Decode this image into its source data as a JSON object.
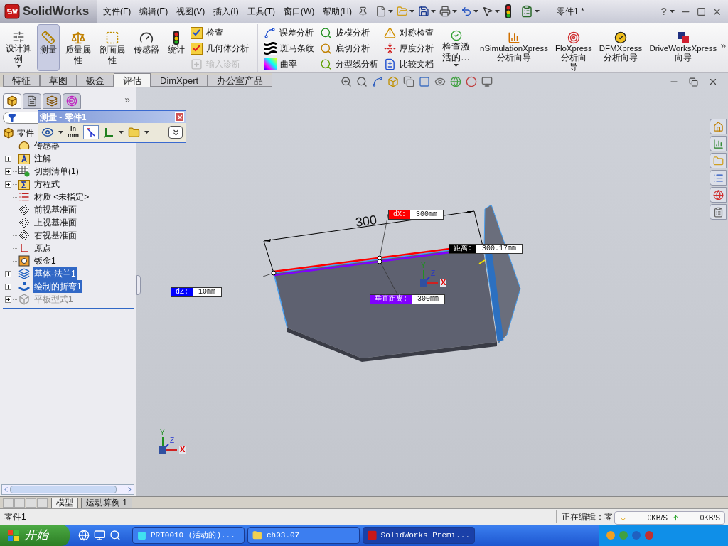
{
  "title_bar": {
    "logo": "SolidWorks",
    "menus": [
      "文件(F)",
      "编辑(E)",
      "视图(V)",
      "插入(I)",
      "工具(T)",
      "窗口(W)",
      "帮助(H)"
    ],
    "document_title": "零件1 *",
    "help": "?"
  },
  "ribbon": {
    "large_buttons": [
      {
        "lines": [
          "设计算",
          "例"
        ],
        "selected": false,
        "dropdown": true
      },
      {
        "lines": [
          "测量"
        ],
        "selected": true,
        "dropdown": false
      },
      {
        "lines": [
          "质量属",
          "性"
        ],
        "selected": false,
        "dropdown": false
      },
      {
        "lines": [
          "剖面属",
          "性"
        ],
        "selected": false,
        "dropdown": false
      },
      {
        "lines": [
          "传感器"
        ],
        "selected": false,
        "dropdown": false
      },
      {
        "lines": [
          "统计"
        ],
        "selected": false,
        "dropdown": false
      }
    ],
    "tool_columns": [
      [
        {
          "label": "检查",
          "disabled": false
        },
        {
          "label": "几何体分析",
          "disabled": false
        },
        {
          "label": "输入诊断",
          "disabled": true
        }
      ],
      [
        {
          "label": "误差分析",
          "disabled": false
        },
        {
          "label": "斑马条纹",
          "disabled": false
        },
        {
          "label": "曲率",
          "disabled": false
        }
      ],
      [
        {
          "label": "拔模分析",
          "disabled": false
        },
        {
          "label": "底切分析",
          "disabled": false
        },
        {
          "label": "分型线分析",
          "disabled": false
        }
      ],
      [
        {
          "label": "对称检查",
          "disabled": false
        },
        {
          "label": "厚度分析",
          "disabled": false
        },
        {
          "label": "比较文档",
          "disabled": false
        }
      ]
    ],
    "check_active": {
      "lines": [
        "检查激",
        "活的…"
      ],
      "dropdown": true
    },
    "xpress_buttons": [
      {
        "lines": [
          "nSimulationXpress",
          "分析向导"
        ]
      },
      {
        "lines": [
          "FloXpress",
          "分析向",
          "导"
        ]
      },
      {
        "lines": [
          "DFMXpress",
          "分析向导"
        ]
      },
      {
        "lines": [
          "DriveWorksXpress",
          "向导"
        ]
      }
    ],
    "overflow": "»"
  },
  "tabs": [
    {
      "label": "特征",
      "selected": false
    },
    {
      "label": "草图",
      "selected": false
    },
    {
      "label": "钣金",
      "selected": false
    },
    {
      "label": "评估",
      "selected": true
    },
    {
      "label": "DimXpert",
      "selected": false
    },
    {
      "label": "办公室产品",
      "selected": false
    }
  ],
  "feature_manager": {
    "panel_tabs": [
      {
        "selected": true
      },
      {
        "selected": false
      },
      {
        "selected": false
      },
      {
        "selected": false
      }
    ],
    "overflow": "»",
    "tree": {
      "label": "零件",
      "children": [
        {
          "label": "传感器",
          "expandable": false,
          "selected": false,
          "suppressed": false
        },
        {
          "label": "注解",
          "expandable": true,
          "selected": false,
          "suppressed": false
        },
        {
          "label": "切割清单(1)",
          "expandable": true,
          "selected": false,
          "suppressed": false
        },
        {
          "label": "方程式",
          "expandable": true,
          "selected": false,
          "suppressed": false
        },
        {
          "label": "材质 <未指定>",
          "expandable": false,
          "selected": false,
          "suppressed": false
        },
        {
          "label": "前视基准面",
          "expandable": false,
          "selected": false,
          "suppressed": false
        },
        {
          "label": "上视基准面",
          "expandable": false,
          "selected": false,
          "suppressed": false
        },
        {
          "label": "右视基准面",
          "expandable": false,
          "selected": false,
          "suppressed": false
        },
        {
          "label": "原点",
          "expandable": false,
          "selected": false,
          "suppressed": false
        },
        {
          "label": "钣金1",
          "expandable": false,
          "selected": false,
          "suppressed": false
        },
        {
          "label": "基体-法兰1",
          "expandable": true,
          "selected": true,
          "suppressed": false
        },
        {
          "label": "绘制的折弯1",
          "expandable": true,
          "selected": true,
          "suppressed": false
        },
        {
          "label": "平板型式1",
          "expandable": true,
          "selected": false,
          "suppressed": true
        }
      ]
    }
  },
  "measure_dialog": {
    "title": "测量 - 零件1",
    "units": [
      "in",
      "mm"
    ]
  },
  "graphics": {
    "dimension": "300",
    "measurements": [
      {
        "label": "dX:",
        "value": "300mm",
        "color": "#ff0000"
      },
      {
        "label": "距离:",
        "value": "300.17mm",
        "color": "#000000"
      },
      {
        "label": "dZ:",
        "value": "10mm",
        "color": "#0000ff"
      },
      {
        "label": "垂直距离:",
        "value": "300mm",
        "color": "#8000ff"
      }
    ],
    "triads": [
      {
        "axes": [
          "X",
          "Y",
          "Z"
        ]
      },
      {
        "axes": [
          "X",
          "Y",
          "Z"
        ]
      }
    ]
  },
  "bottom_tabs": [
    {
      "label": "模型",
      "selected": true
    },
    {
      "label": "运动算例 1",
      "selected": false
    }
  ],
  "status_bar": {
    "left": "零件1",
    "right": "正在编辑：零"
  },
  "network_monitor": {
    "download": "0KB/S",
    "upload": "0KB/S"
  },
  "taskbar": {
    "start": "开始",
    "tasks": [
      {
        "label": "PRT0010 (活动的)...",
        "selected": false
      },
      {
        "label": "ch03.07",
        "selected": false
      },
      {
        "label": "SolidWorks Premi...",
        "selected": true
      }
    ]
  }
}
